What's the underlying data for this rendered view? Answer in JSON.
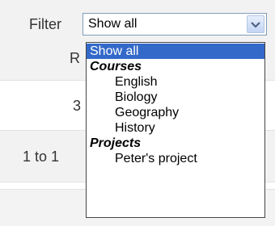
{
  "filter": {
    "label": "Filter",
    "selected_value": "Show all",
    "dropdown": {
      "top_option": "Show all",
      "groups": [
        {
          "label": "Courses",
          "options": [
            "English",
            "Biology",
            "Geography",
            "History"
          ]
        },
        {
          "label": "Projects",
          "options": [
            "Peter's project"
          ]
        }
      ]
    }
  },
  "background": {
    "column_header_fragment": "R",
    "cell_fragment": "3",
    "pagination_fragment": "1 to 1"
  },
  "colors": {
    "highlight": "#3369c9",
    "page_band": "#f2f2f2"
  },
  "icons": [
    "chevron-down-icon"
  ]
}
